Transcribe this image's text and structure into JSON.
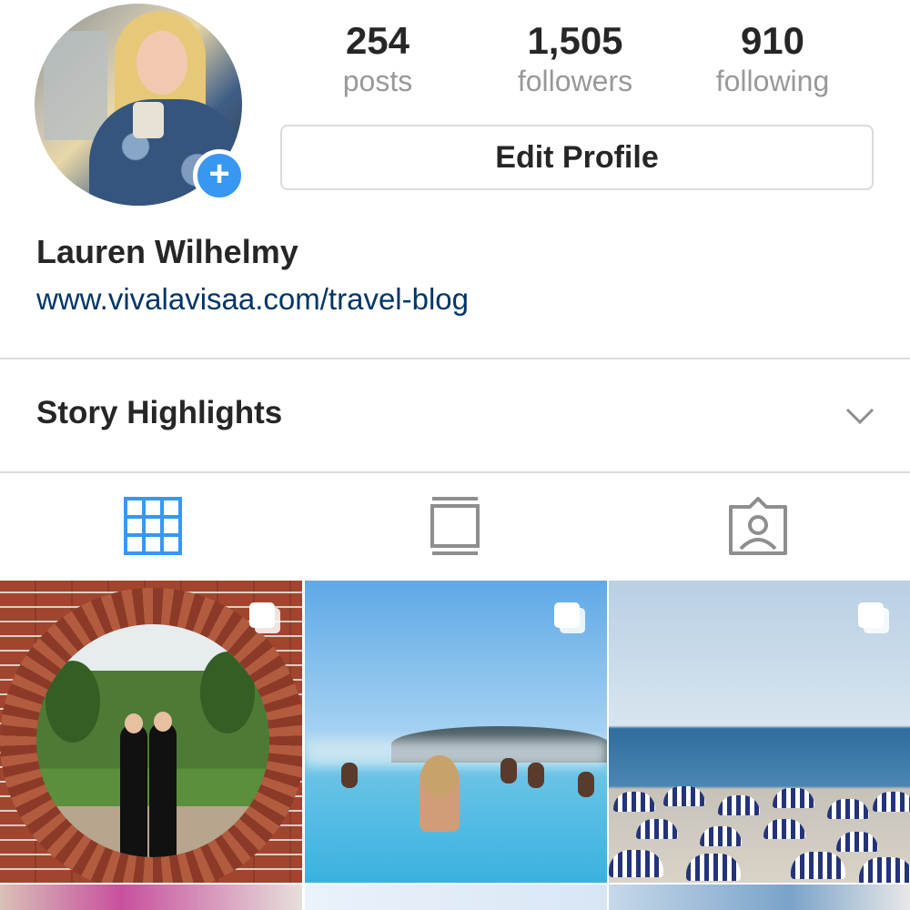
{
  "profile": {
    "name": "Lauren Wilhelmy",
    "link": "www.vivalavisaa.com/travel-blog",
    "add_icon": "+"
  },
  "stats": [
    {
      "value": "254",
      "label": "posts"
    },
    {
      "value": "1,505",
      "label": "followers"
    },
    {
      "value": "910",
      "label": "following"
    }
  ],
  "actions": {
    "edit_profile": "Edit Profile"
  },
  "highlights": {
    "title": "Story Highlights",
    "chevron_icon": "chevron-down-icon"
  },
  "tabs": [
    {
      "icon": "grid-icon",
      "active": true
    },
    {
      "icon": "feed-list-icon",
      "active": false
    },
    {
      "icon": "tagged-person-icon",
      "active": false
    }
  ],
  "colors": {
    "accent": "#3897f0",
    "link": "#003569",
    "muted": "#999999",
    "border": "#dbdbdb",
    "active_tab": "#3897f0",
    "inactive_tab": "#8e8e8e"
  },
  "posts": [
    {
      "subject": "brick-arch-two-women",
      "multi": true
    },
    {
      "subject": "blue-lagoon-swimmers",
      "multi": true
    },
    {
      "subject": "beach-umbrellas",
      "multi": true
    }
  ]
}
